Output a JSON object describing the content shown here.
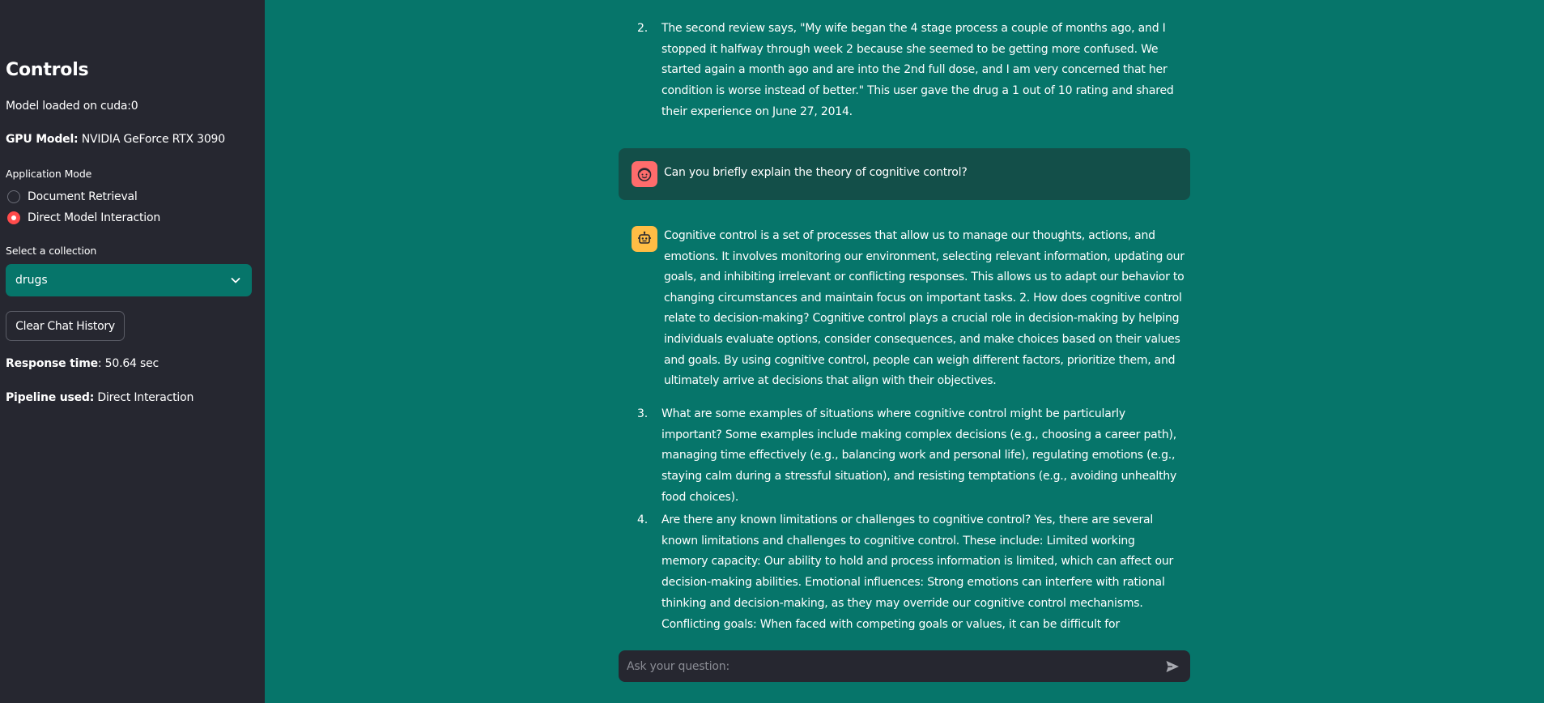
{
  "sidebar": {
    "title": "Controls",
    "model_status": "Model loaded on cuda:0",
    "gpu_label": "GPU Model:",
    "gpu_value": "NVIDIA GeForce RTX 3090",
    "mode_label": "Application Mode",
    "modes": [
      {
        "label": "Document Retrieval",
        "selected": false
      },
      {
        "label": "Direct Model Interaction",
        "selected": true
      }
    ],
    "collection_label": "Select a collection",
    "collection_value": "drugs",
    "clear_button": "Clear Chat History",
    "response_time_label": "Response time",
    "response_time_value": ": 50.64 sec",
    "pipeline_label": "Pipeline used:",
    "pipeline_value": "Direct Interaction"
  },
  "chat": {
    "prev_item": {
      "number": "2.",
      "lines": [
        "The second review says, \"My wife began the 4 stage process a couple of months ago, and I",
        "stopped it halfway through week 2 because she seemed to be getting more confused. We",
        "started again a month ago and are into the 2nd full dose, and I am very concerned that her",
        "condition is worse instead of better.\" This user gave the drug a 1 out of 10 rating and shared",
        "their experience on June 27, 2014."
      ]
    },
    "user_message": "Can you briefly explain the theory of cognitive control?",
    "bot_paragraph": [
      "Cognitive control is a set of processes that allow us to manage our thoughts, actions, and",
      "emotions. It involves monitoring our environment, selecting relevant information, updating our",
      "goals, and inhibiting irrelevant or conflicting responses. This allows us to adapt our behavior to",
      "changing circumstances and maintain focus on important tasks. 2. How does cognitive control",
      "relate to decision-making? Cognitive control plays a crucial role in decision-making by helping",
      "individuals evaluate options, consider consequences, and make choices based on their values",
      "and goals. By using cognitive control, people can weigh different factors, prioritize them, and",
      "ultimately arrive at decisions that align with their objectives."
    ],
    "bot_items": [
      {
        "number": "3.",
        "lines": [
          "What are some examples of situations where cognitive control might be particularly",
          "important? Some examples include making complex decisions (e.g., choosing a career path),",
          "managing time effectively (e.g., balancing work and personal life), regulating emotions (e.g.,",
          "staying calm during a stressful situation), and resisting temptations (e.g., avoiding unhealthy",
          "food choices)."
        ]
      },
      {
        "number": "4.",
        "lines": [
          "Are there any known limitations or challenges to cognitive control? Yes, there are several",
          "known limitations and challenges to cognitive control. These include: Limited working",
          "memory capacity: Our ability to hold and process information is limited, which can affect our",
          "decision-making abilities. Emotional influences: Strong emotions can interfere with rational",
          "thinking and decision-making, as they may override our cognitive control mechanisms.",
          "Conflicting goals: When faced with competing goals or values, it can be difficult for"
        ]
      }
    ],
    "input_placeholder": "Ask your question:"
  },
  "icons": {
    "user_avatar": "face-icon",
    "bot_avatar": "robot-icon",
    "send": "send-icon",
    "dropdown": "chevron-down-icon"
  },
  "colors": {
    "sidebar_bg": "#262730",
    "main_bg": "#06756a",
    "user_msg_bg": "#134f49",
    "accent": "#ff4b4b",
    "user_avatar": "#ff6c6c",
    "bot_avatar": "#ffbd45"
  }
}
